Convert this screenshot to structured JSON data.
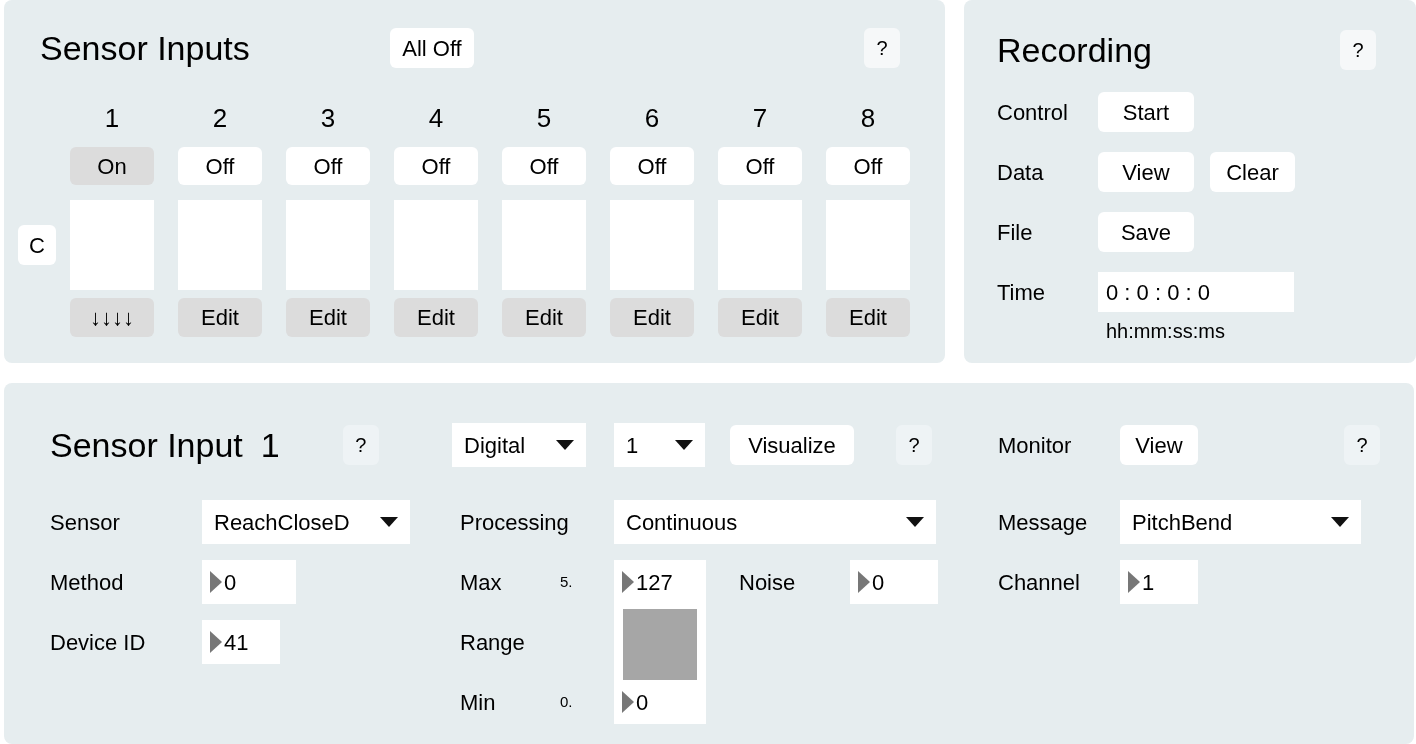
{
  "sensor_inputs": {
    "title": "Sensor Inputs",
    "all_off": "All Off",
    "help": "?",
    "c_button": "C",
    "channels": [
      {
        "number": "1",
        "power": "On",
        "on": true,
        "action": "↓↓↓↓"
      },
      {
        "number": "2",
        "power": "Off",
        "on": false,
        "action": "Edit"
      },
      {
        "number": "3",
        "power": "Off",
        "on": false,
        "action": "Edit"
      },
      {
        "number": "4",
        "power": "Off",
        "on": false,
        "action": "Edit"
      },
      {
        "number": "5",
        "power": "Off",
        "on": false,
        "action": "Edit"
      },
      {
        "number": "6",
        "power": "Off",
        "on": false,
        "action": "Edit"
      },
      {
        "number": "7",
        "power": "Off",
        "on": false,
        "action": "Edit"
      },
      {
        "number": "8",
        "power": "Off",
        "on": false,
        "action": "Edit"
      }
    ]
  },
  "recording": {
    "title": "Recording",
    "help": "?",
    "rows": [
      {
        "label": "Control",
        "kind": "buttons",
        "buttons": [
          "Start"
        ]
      },
      {
        "label": "Data",
        "kind": "buttons",
        "buttons": [
          "View",
          "Clear"
        ]
      },
      {
        "label": "File",
        "kind": "buttons",
        "buttons": [
          "Save"
        ]
      },
      {
        "label": "Time",
        "kind": "time",
        "value": "0 : 0 : 0 : 0",
        "format": "hh:mm:ss:ms"
      }
    ]
  },
  "sensor_input": {
    "title": "Sensor Input",
    "number": "1",
    "help": "?",
    "mode": "Digital",
    "channel_select": "1",
    "visualize": "Visualize",
    "help_2": "?",
    "monitor": {
      "label": "Monitor",
      "button": "View"
    },
    "help_3": "?",
    "sensor": {
      "label": "Sensor",
      "value": "ReachCloseD"
    },
    "method": {
      "label": "Method",
      "value": "0"
    },
    "device_id": {
      "label": "Device ID",
      "value": "41"
    },
    "processing": {
      "label": "Processing",
      "value": "Continuous"
    },
    "max": {
      "label": "Max",
      "hint": "5.",
      "value": "127"
    },
    "range": {
      "label": "Range",
      "level": 0.93
    },
    "min": {
      "label": "Min",
      "hint": "0.",
      "value": "0"
    },
    "noise": {
      "label": "Noise",
      "value": "0"
    },
    "message": {
      "label": "Message",
      "value": "PitchBend"
    },
    "channel": {
      "label": "Channel",
      "value": "1"
    }
  }
}
